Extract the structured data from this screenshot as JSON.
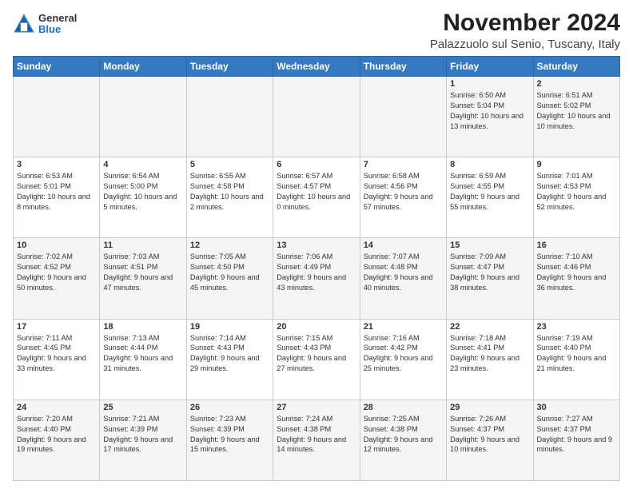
{
  "logo": {
    "general": "General",
    "blue": "Blue"
  },
  "header": {
    "month": "November 2024",
    "location": "Palazzuolo sul Senio, Tuscany, Italy"
  },
  "days": [
    "Sunday",
    "Monday",
    "Tuesday",
    "Wednesday",
    "Thursday",
    "Friday",
    "Saturday"
  ],
  "weeks": [
    [
      {
        "day": "",
        "info": ""
      },
      {
        "day": "",
        "info": ""
      },
      {
        "day": "",
        "info": ""
      },
      {
        "day": "",
        "info": ""
      },
      {
        "day": "",
        "info": ""
      },
      {
        "day": "1",
        "info": "Sunrise: 6:50 AM\nSunset: 5:04 PM\nDaylight: 10 hours and 13 minutes."
      },
      {
        "day": "2",
        "info": "Sunrise: 6:51 AM\nSunset: 5:02 PM\nDaylight: 10 hours and 10 minutes."
      }
    ],
    [
      {
        "day": "3",
        "info": "Sunrise: 6:53 AM\nSunset: 5:01 PM\nDaylight: 10 hours and 8 minutes."
      },
      {
        "day": "4",
        "info": "Sunrise: 6:54 AM\nSunset: 5:00 PM\nDaylight: 10 hours and 5 minutes."
      },
      {
        "day": "5",
        "info": "Sunrise: 6:55 AM\nSunset: 4:58 PM\nDaylight: 10 hours and 2 minutes."
      },
      {
        "day": "6",
        "info": "Sunrise: 6:57 AM\nSunset: 4:57 PM\nDaylight: 10 hours and 0 minutes."
      },
      {
        "day": "7",
        "info": "Sunrise: 6:58 AM\nSunset: 4:56 PM\nDaylight: 9 hours and 57 minutes."
      },
      {
        "day": "8",
        "info": "Sunrise: 6:59 AM\nSunset: 4:55 PM\nDaylight: 9 hours and 55 minutes."
      },
      {
        "day": "9",
        "info": "Sunrise: 7:01 AM\nSunset: 4:53 PM\nDaylight: 9 hours and 52 minutes."
      }
    ],
    [
      {
        "day": "10",
        "info": "Sunrise: 7:02 AM\nSunset: 4:52 PM\nDaylight: 9 hours and 50 minutes."
      },
      {
        "day": "11",
        "info": "Sunrise: 7:03 AM\nSunset: 4:51 PM\nDaylight: 9 hours and 47 minutes."
      },
      {
        "day": "12",
        "info": "Sunrise: 7:05 AM\nSunset: 4:50 PM\nDaylight: 9 hours and 45 minutes."
      },
      {
        "day": "13",
        "info": "Sunrise: 7:06 AM\nSunset: 4:49 PM\nDaylight: 9 hours and 43 minutes."
      },
      {
        "day": "14",
        "info": "Sunrise: 7:07 AM\nSunset: 4:48 PM\nDaylight: 9 hours and 40 minutes."
      },
      {
        "day": "15",
        "info": "Sunrise: 7:09 AM\nSunset: 4:47 PM\nDaylight: 9 hours and 38 minutes."
      },
      {
        "day": "16",
        "info": "Sunrise: 7:10 AM\nSunset: 4:46 PM\nDaylight: 9 hours and 36 minutes."
      }
    ],
    [
      {
        "day": "17",
        "info": "Sunrise: 7:11 AM\nSunset: 4:45 PM\nDaylight: 9 hours and 33 minutes."
      },
      {
        "day": "18",
        "info": "Sunrise: 7:13 AM\nSunset: 4:44 PM\nDaylight: 9 hours and 31 minutes."
      },
      {
        "day": "19",
        "info": "Sunrise: 7:14 AM\nSunset: 4:43 PM\nDaylight: 9 hours and 29 minutes."
      },
      {
        "day": "20",
        "info": "Sunrise: 7:15 AM\nSunset: 4:43 PM\nDaylight: 9 hours and 27 minutes."
      },
      {
        "day": "21",
        "info": "Sunrise: 7:16 AM\nSunset: 4:42 PM\nDaylight: 9 hours and 25 minutes."
      },
      {
        "day": "22",
        "info": "Sunrise: 7:18 AM\nSunset: 4:41 PM\nDaylight: 9 hours and 23 minutes."
      },
      {
        "day": "23",
        "info": "Sunrise: 7:19 AM\nSunset: 4:40 PM\nDaylight: 9 hours and 21 minutes."
      }
    ],
    [
      {
        "day": "24",
        "info": "Sunrise: 7:20 AM\nSunset: 4:40 PM\nDaylight: 9 hours and 19 minutes."
      },
      {
        "day": "25",
        "info": "Sunrise: 7:21 AM\nSunset: 4:39 PM\nDaylight: 9 hours and 17 minutes."
      },
      {
        "day": "26",
        "info": "Sunrise: 7:23 AM\nSunset: 4:39 PM\nDaylight: 9 hours and 15 minutes."
      },
      {
        "day": "27",
        "info": "Sunrise: 7:24 AM\nSunset: 4:38 PM\nDaylight: 9 hours and 14 minutes."
      },
      {
        "day": "28",
        "info": "Sunrise: 7:25 AM\nSunset: 4:38 PM\nDaylight: 9 hours and 12 minutes."
      },
      {
        "day": "29",
        "info": "Sunrise: 7:26 AM\nSunset: 4:37 PM\nDaylight: 9 hours and 10 minutes."
      },
      {
        "day": "30",
        "info": "Sunrise: 7:27 AM\nSunset: 4:37 PM\nDaylight: 9 hours and 9 minutes."
      }
    ]
  ]
}
